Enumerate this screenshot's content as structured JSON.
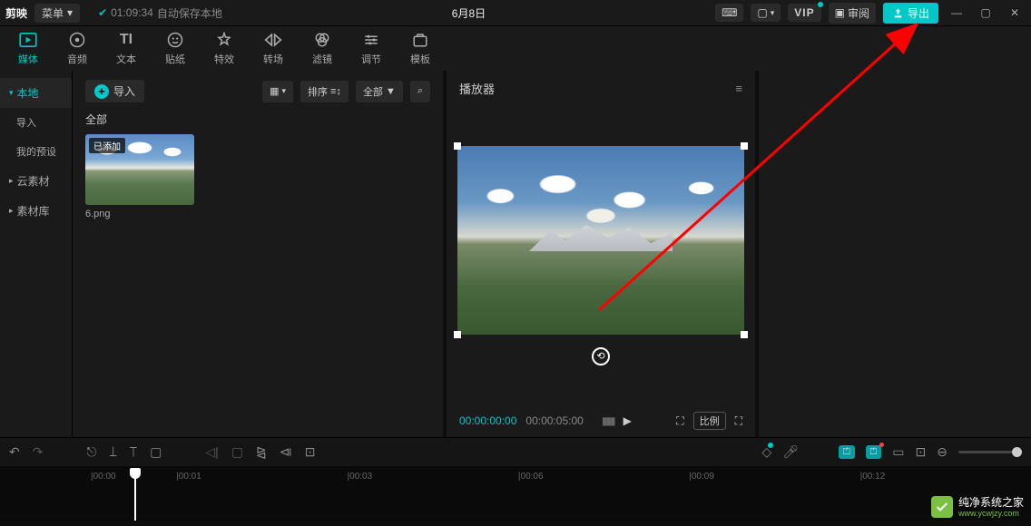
{
  "topbar": {
    "logo": "剪映",
    "menu": "菜单",
    "autosave_time": "01:09:34",
    "autosave_text": "自动保存本地",
    "title": "6月8日",
    "review": "审阅",
    "export": "导出"
  },
  "tooltabs": [
    {
      "label": "媒体",
      "icon": "media"
    },
    {
      "label": "音频",
      "icon": "audio"
    },
    {
      "label": "文本",
      "icon": "text"
    },
    {
      "label": "贴纸",
      "icon": "sticker"
    },
    {
      "label": "特效",
      "icon": "effect"
    },
    {
      "label": "转场",
      "icon": "transition"
    },
    {
      "label": "滤镜",
      "icon": "filter"
    },
    {
      "label": "调节",
      "icon": "adjust"
    },
    {
      "label": "模板",
      "icon": "template"
    }
  ],
  "sidenav": {
    "local": "本地",
    "import": "导入",
    "presets": "我的预设",
    "cloud": "云素材",
    "library": "素材库"
  },
  "media": {
    "import_btn": "导入",
    "sort": "排序",
    "all_filter": "全部",
    "section": "全部",
    "thumb_badge": "已添加",
    "thumb_name": "6.png"
  },
  "player": {
    "title": "播放器",
    "tc_current": "00:00:00:00",
    "tc_duration": "00:00:05:00",
    "ratio": "比例"
  },
  "ruler": [
    "|00:00",
    "|00:01",
    "|00:03",
    "|00:06",
    "|00:09",
    "|00:12"
  ],
  "watermark": {
    "name": "纯净系统之家",
    "url": "www.ycwjzy.com"
  }
}
